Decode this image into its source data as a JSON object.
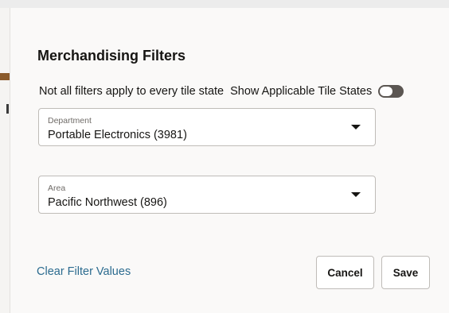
{
  "dialog": {
    "title": "Merchandising Filters",
    "info_text": "Not all filters apply to every tile state",
    "toggle_label": "Show Applicable Tile States",
    "toggle_on": false
  },
  "filters": {
    "department": {
      "label": "Department",
      "value": "Portable Electronics (3981)"
    },
    "area": {
      "label": "Area",
      "value": "Pacific Northwest (896)"
    }
  },
  "actions": {
    "clear_label": "Clear Filter Values",
    "cancel_label": "Cancel",
    "save_label": "Save"
  },
  "colors": {
    "link": "#2b6b8f",
    "toggle_off": "#5b5652",
    "dialog_bg": "#faf9f8"
  }
}
